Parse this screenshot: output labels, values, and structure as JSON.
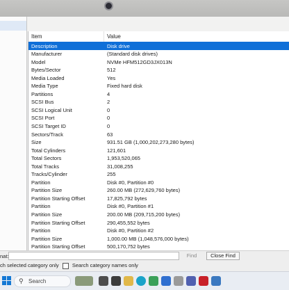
{
  "table": {
    "header": {
      "item": "Item",
      "value": "Value"
    },
    "rows": [
      {
        "key": "Description",
        "value": "Disk drive",
        "selected": true
      },
      {
        "key": "Manufacturer",
        "value": "(Standard disk drives)"
      },
      {
        "key": "Model",
        "value": "NVMe HFM512GD3JX013N"
      },
      {
        "key": "Bytes/Sector",
        "value": "512"
      },
      {
        "key": "Media Loaded",
        "value": "Yes"
      },
      {
        "key": "Media Type",
        "value": "Fixed hard disk"
      },
      {
        "key": "Partitions",
        "value": "4"
      },
      {
        "key": "SCSI Bus",
        "value": "2"
      },
      {
        "key": "SCSI Logical Unit",
        "value": "0"
      },
      {
        "key": "SCSI Port",
        "value": "0"
      },
      {
        "key": "SCSI Target ID",
        "value": "0"
      },
      {
        "key": "Sectors/Track",
        "value": "63"
      },
      {
        "key": "Size",
        "value": "931.51 GB (1,000,202,273,280 bytes)"
      },
      {
        "key": "Total Cylinders",
        "value": "121,601"
      },
      {
        "key": "Total Sectors",
        "value": "1,953,520,065"
      },
      {
        "key": "Total Tracks",
        "value": "31,008,255"
      },
      {
        "key": "Tracks/Cylinder",
        "value": "255"
      },
      {
        "key": "Partition",
        "value": "Disk #0, Partition #0"
      },
      {
        "key": "Partition Size",
        "value": "260.00 MB (272,629,760 bytes)"
      },
      {
        "key": "Partition Starting Offset",
        "value": "17,825,792 bytes"
      },
      {
        "key": "Partition",
        "value": "Disk #0, Partition #1"
      },
      {
        "key": "Partition Size",
        "value": "200.00 MB (209,715,200 bytes)"
      },
      {
        "key": "Partition Starting Offset",
        "value": "290,455,552 bytes"
      },
      {
        "key": "Partition",
        "value": "Disk #0, Partition #2"
      },
      {
        "key": "Partition Size",
        "value": "1,000.00 MB (1,048,576,000 bytes)"
      },
      {
        "key": "Partition Starting Offset",
        "value": "500,170,752 bytes"
      }
    ]
  },
  "find": {
    "label": "nat:",
    "find_button": "Find",
    "close_find_button": "Close Find",
    "checkbox_selected_category": "ch selected category only",
    "checkbox_category_names": "Search category names only"
  },
  "taskbar": {
    "search_label": "Search"
  },
  "colors": {
    "selection": "#0f6fd8",
    "taskbar": "#e9edf3",
    "windows_blue": "#1478d4"
  }
}
